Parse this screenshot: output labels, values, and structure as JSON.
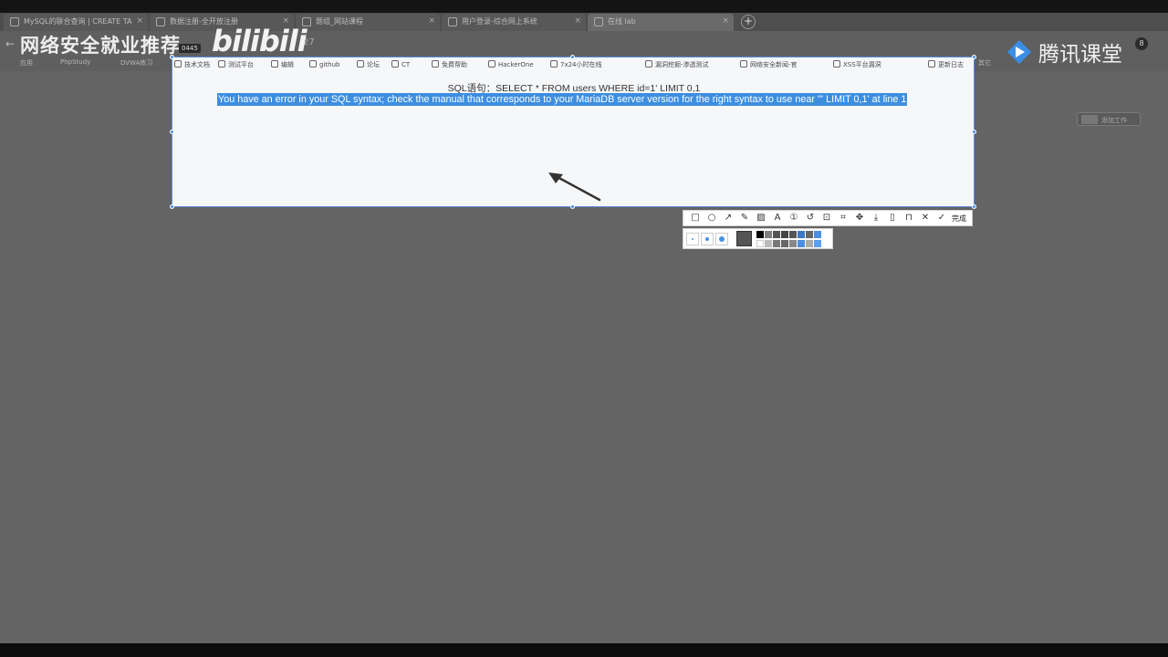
{
  "browser": {
    "tabs": [
      {
        "label": "MySQL的联合查询 | CREATE TA"
      },
      {
        "label": "数据注册-全开放注册"
      },
      {
        "label": "题组_网站课程"
      },
      {
        "label": "用户登录-综合网上系统"
      },
      {
        "label": "在线 lab"
      }
    ],
    "new_tab_label": "+",
    "url_fragment": "27",
    "bookmarks": [
      "应用",
      "PhpStudy",
      "DVWA练习",
      "其它"
    ]
  },
  "watermark": {
    "left_text": "网络安全就业推荐",
    "bili_text": "bilibili",
    "right_text": "腾讯课堂",
    "notification_count": "8",
    "time_badge": "0445"
  },
  "capture": {
    "bookmarks": [
      "技术文档",
      "测试平台",
      "编辑",
      "github",
      "论坛",
      "CT",
      "免费帮助",
      "HackerOne",
      "7x24小时在线",
      "漏洞挖掘-渗透测试",
      "网络安全新闻-官",
      "XSS平台漏洞",
      "更新日志"
    ],
    "sql_label": "SQL语句：SELECT * FROM users WHERE id=1' LIMIT 0,1",
    "error_message": "You have an error in your SQL syntax; check the manual that corresponds to your MariaDB server version for the right syntax to use near ''' LIMIT 0,1' at line 1"
  },
  "screenshot_tool": {
    "tools": [
      "rectangle-icon",
      "ellipse-icon",
      "arrow-icon",
      "pen-icon",
      "mosaic-icon",
      "text-icon",
      "number-icon",
      "undo-icon",
      "ocr-icon",
      "translate-icon",
      "pin-icon",
      "save-icon",
      "long-shot-icon",
      "bookmark-icon",
      "close-icon"
    ],
    "done_label": "完成"
  },
  "side_button_label": "添加工作",
  "colors": {
    "accent": "#3d8ee0",
    "dim_background": "#646464",
    "capture_background": "#f6f7f9"
  }
}
